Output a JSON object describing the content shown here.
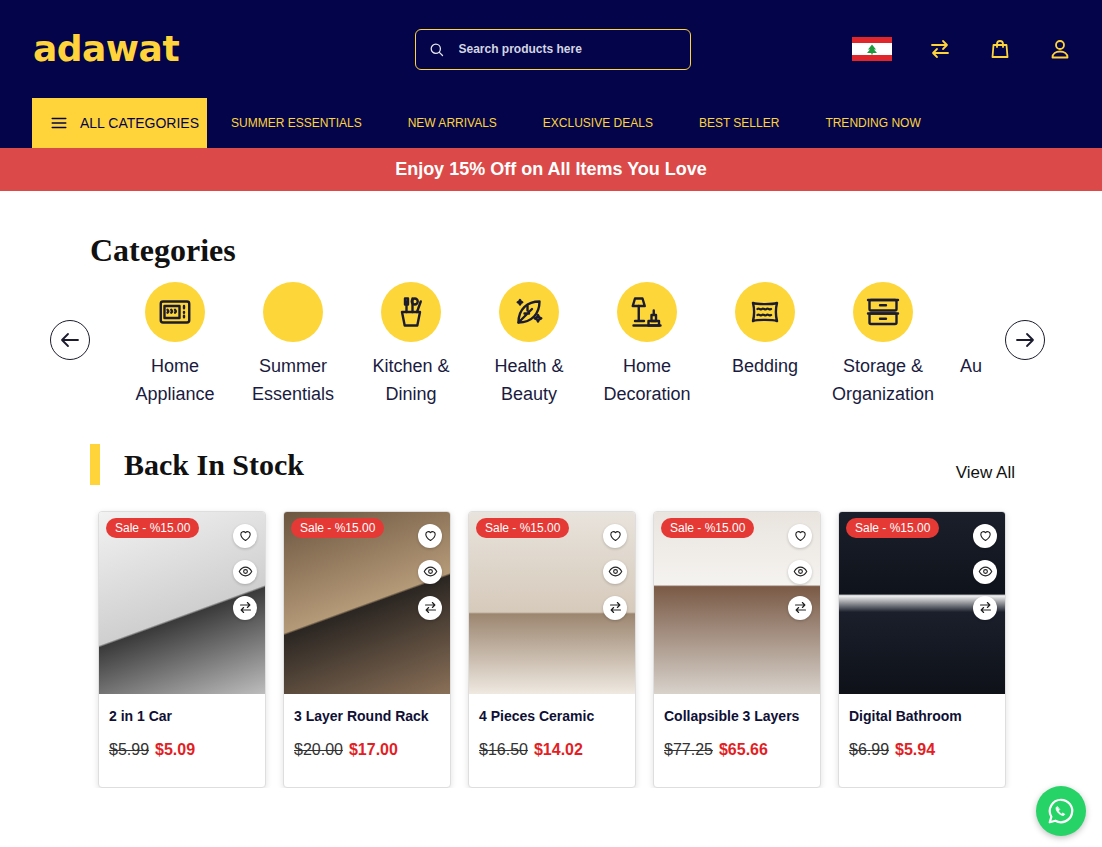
{
  "header": {
    "logo": "adawat",
    "search": {
      "placeholder": "Search products here"
    }
  },
  "nav": {
    "all_categories": "ALL CATEGORIES",
    "links": [
      "SUMMER ESSENTIALS",
      "NEW ARRIVALS",
      "EXCLUSIVE DEALS",
      "BEST SELLER",
      "TRENDING NOW"
    ]
  },
  "banner": "Enjoy 15% Off on All Items You Love",
  "categories": {
    "title": "Categories",
    "items": [
      {
        "label": "Home Appliance"
      },
      {
        "label": "Summer Essentials"
      },
      {
        "label": "Kitchen & Dining"
      },
      {
        "label": "Health & Beauty"
      },
      {
        "label": "Home Decoration"
      },
      {
        "label": "Bedding"
      },
      {
        "label": "Storage & Organization"
      },
      {
        "label": "Au"
      }
    ]
  },
  "back_in_stock": {
    "title": "Back In Stock",
    "view_all": "View All",
    "products": [
      {
        "name": "2 in 1 Car",
        "badge": "Sale - %15.00",
        "old_price": "$5.99",
        "price": "$5.09"
      },
      {
        "name": "3 Layer Round Rack",
        "badge": "Sale - %15.00",
        "old_price": "$20.00",
        "price": "$17.00"
      },
      {
        "name": "4 Pieces Ceramic",
        "badge": "Sale - %15.00",
        "old_price": "$16.50",
        "price": "$14.02"
      },
      {
        "name": "Collapsible 3 Layers",
        "badge": "Sale - %15.00",
        "old_price": "$77.25",
        "price": "$65.66"
      },
      {
        "name": "Digital Bathroom",
        "badge": "Sale - %15.00",
        "old_price": "$6.99",
        "price": "$5.94"
      }
    ]
  }
}
